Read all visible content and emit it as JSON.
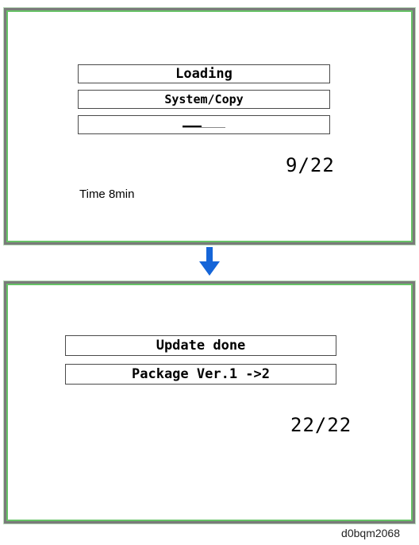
{
  "screen_loading": {
    "title": "Loading",
    "target": "System/Copy",
    "progress_fraction": 0.45,
    "counter": "9/22",
    "time_label": "Time 8min"
  },
  "screen_done": {
    "status": "Update done",
    "package": "Package Ver.1 ->2",
    "counter": "22/22"
  },
  "arrow": {
    "icon": "arrow-down-icon",
    "color": "#1565d8"
  },
  "caption": "d0bqm2068",
  "colors": {
    "panel_border": "#7a7a7a",
    "panel_glow": "#66c266"
  }
}
